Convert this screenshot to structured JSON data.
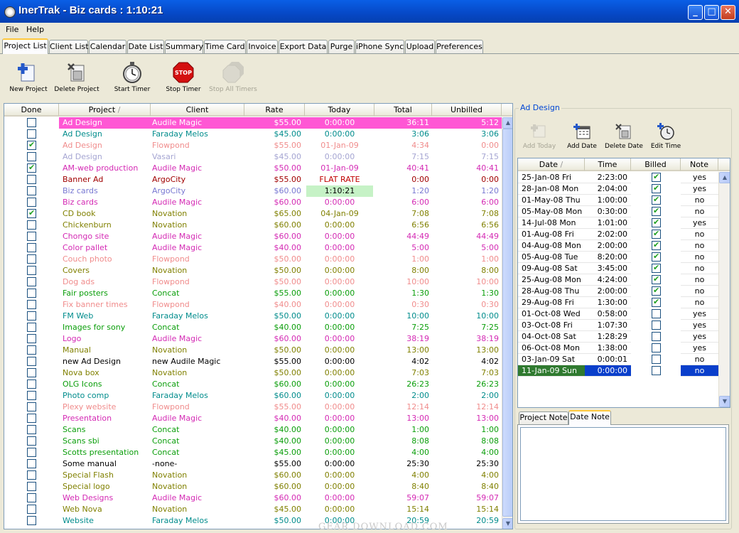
{
  "window": {
    "title": "InerTrak - Biz cards : 1:10:21",
    "minimize_glyph": "_",
    "maximize_glyph": "□",
    "close_glyph": "✕"
  },
  "menu": [
    "File",
    "Help"
  ],
  "tabs": [
    "Project List",
    "Client List",
    "Calendar",
    "Date List",
    "Summary",
    "Time Card",
    "Invoice",
    "Export Data",
    "Purge",
    "iPhone Sync",
    "Upload",
    "Preferences"
  ],
  "active_tab": "Project List",
  "toolbar": [
    {
      "label": "New Project",
      "icon": "new-project-icon",
      "enabled": true
    },
    {
      "label": "Delete Project",
      "icon": "delete-project-icon",
      "enabled": true
    },
    {
      "label": "Start Timer",
      "icon": "stopwatch-icon",
      "enabled": true
    },
    {
      "label": "Stop Timer",
      "icon": "stop-sign-icon",
      "enabled": true
    },
    {
      "label": "Stop All Timers",
      "icon": "stop-all-icon",
      "enabled": false
    }
  ],
  "project_table": {
    "columns": [
      "Done",
      "Project",
      "Client",
      "Rate",
      "Today",
      "Total",
      "Unbilled"
    ],
    "sort_indicator": "/",
    "rows": [
      {
        "done": false,
        "project": "Ad Design",
        "client": "Audile Magic",
        "rate": "$55.00",
        "today": "0:00:00",
        "total": "36:11",
        "unbilled": "5:12",
        "color": "#d42ab4",
        "selected": true
      },
      {
        "done": false,
        "project": "Ad Design",
        "client": "Faraday Melos",
        "rate": "$45.00",
        "today": "0:00:00",
        "total": "3:06",
        "unbilled": "3:06",
        "color": "#008c8c"
      },
      {
        "done": true,
        "project": "Ad Design",
        "client": "Flowpond",
        "rate": "$55.00",
        "today": "01-Jan-09",
        "total": "4:34",
        "unbilled": "0:00",
        "color": "#f08c8c"
      },
      {
        "done": false,
        "project": "Ad Design",
        "client": "Vasari",
        "rate": "$45.00",
        "today": "0:00:00",
        "total": "7:15",
        "unbilled": "7:15",
        "color": "#a5a5d2"
      },
      {
        "done": true,
        "project": "AM-web production",
        "client": "Audile Magic",
        "rate": "$50.00",
        "today": "01-Jan-09",
        "total": "40:41",
        "unbilled": "40:41",
        "color": "#d42ab4"
      },
      {
        "done": false,
        "project": "Banner Ad",
        "client": "ArgoCity",
        "rate": "$55.00",
        "today": "FLAT RATE",
        "total": "0:00",
        "unbilled": "0:00",
        "color": "#a00000",
        "today_color": "#c00000"
      },
      {
        "done": false,
        "project": "Biz cards",
        "client": "ArgoCity",
        "rate": "$60.00",
        "today": "1:10:21",
        "total": "1:20",
        "unbilled": "1:20",
        "color": "#7878d2",
        "today_highlight": true
      },
      {
        "done": false,
        "project": "Biz cards",
        "client": "Audile Magic",
        "rate": "$60.00",
        "today": "0:00:00",
        "total": "6:00",
        "unbilled": "6:00",
        "color": "#d42ab4"
      },
      {
        "done": true,
        "project": "CD book",
        "client": "Novation",
        "rate": "$65.00",
        "today": "04-Jan-09",
        "total": "7:08",
        "unbilled": "7:08",
        "color": "#808000"
      },
      {
        "done": false,
        "project": "Chickenburn",
        "client": "Novation",
        "rate": "$60.00",
        "today": "0:00:00",
        "total": "6:56",
        "unbilled": "6:56",
        "color": "#808000"
      },
      {
        "done": false,
        "project": "Chongo site",
        "client": "Audile Magic",
        "rate": "$60.00",
        "today": "0:00:00",
        "total": "44:49",
        "unbilled": "44:49",
        "color": "#d42ab4"
      },
      {
        "done": false,
        "project": "Color pallet",
        "client": "Audile Magic",
        "rate": "$40.00",
        "today": "0:00:00",
        "total": "5:00",
        "unbilled": "5:00",
        "color": "#d42ab4"
      },
      {
        "done": false,
        "project": "Couch photo",
        "client": "Flowpond",
        "rate": "$50.00",
        "today": "0:00:00",
        "total": "1:00",
        "unbilled": "1:00",
        "color": "#f08c8c"
      },
      {
        "done": false,
        "project": "Covers",
        "client": "Novation",
        "rate": "$50.00",
        "today": "0:00:00",
        "total": "8:00",
        "unbilled": "8:00",
        "color": "#808000"
      },
      {
        "done": false,
        "project": "Dog ads",
        "client": "Flowpond",
        "rate": "$50.00",
        "today": "0:00:00",
        "total": "10:00",
        "unbilled": "10:00",
        "color": "#f08c8c"
      },
      {
        "done": false,
        "project": "Fair posters",
        "client": "Concat",
        "rate": "$55.00",
        "today": "0:00:00",
        "total": "1:30",
        "unbilled": "1:30",
        "color": "#0a9e0a"
      },
      {
        "done": false,
        "project": "Fix banner times",
        "client": "Flowpond",
        "rate": "$40.00",
        "today": "0:00:00",
        "total": "0:30",
        "unbilled": "0:30",
        "color": "#f08c8c"
      },
      {
        "done": false,
        "project": "FM Web",
        "client": "Faraday Melos",
        "rate": "$50.00",
        "today": "0:00:00",
        "total": "10:00",
        "unbilled": "10:00",
        "color": "#008c8c"
      },
      {
        "done": false,
        "project": "Images for sony",
        "client": "Concat",
        "rate": "$40.00",
        "today": "0:00:00",
        "total": "7:25",
        "unbilled": "7:25",
        "color": "#0a9e0a"
      },
      {
        "done": false,
        "project": "Logo",
        "client": "Audile Magic",
        "rate": "$60.00",
        "today": "0:00:00",
        "total": "38:19",
        "unbilled": "38:19",
        "color": "#d42ab4"
      },
      {
        "done": false,
        "project": "Manual",
        "client": "Novation",
        "rate": "$50.00",
        "today": "0:00:00",
        "total": "13:00",
        "unbilled": "13:00",
        "color": "#808000"
      },
      {
        "done": false,
        "project": "new Ad Design",
        "client": "new Audile Magic",
        "rate": "$55.00",
        "today": "0:00:00",
        "total": "4:02",
        "unbilled": "4:02",
        "color": "#000000"
      },
      {
        "done": false,
        "project": "Nova box",
        "client": "Novation",
        "rate": "$50.00",
        "today": "0:00:00",
        "total": "7:03",
        "unbilled": "7:03",
        "color": "#808000"
      },
      {
        "done": false,
        "project": "OLG Icons",
        "client": "Concat",
        "rate": "$60.00",
        "today": "0:00:00",
        "total": "26:23",
        "unbilled": "26:23",
        "color": "#0a9e0a"
      },
      {
        "done": false,
        "project": "Photo comp",
        "client": "Faraday Melos",
        "rate": "$60.00",
        "today": "0:00:00",
        "total": "2:00",
        "unbilled": "2:00",
        "color": "#008c8c"
      },
      {
        "done": false,
        "project": "Plexy website",
        "client": "Flowpond",
        "rate": "$55.00",
        "today": "0:00:00",
        "total": "12:14",
        "unbilled": "12:14",
        "color": "#f08c8c"
      },
      {
        "done": false,
        "project": "Presentation",
        "client": "Audile Magic",
        "rate": "$40.00",
        "today": "0:00:00",
        "total": "13:00",
        "unbilled": "13:00",
        "color": "#d42ab4"
      },
      {
        "done": false,
        "project": "Scans",
        "client": "Concat",
        "rate": "$40.00",
        "today": "0:00:00",
        "total": "1:00",
        "unbilled": "1:00",
        "color": "#0a9e0a"
      },
      {
        "done": false,
        "project": "Scans sbi",
        "client": "Concat",
        "rate": "$40.00",
        "today": "0:00:00",
        "total": "8:08",
        "unbilled": "8:08",
        "color": "#0a9e0a"
      },
      {
        "done": false,
        "project": "Scotts presentation",
        "client": "Concat",
        "rate": "$45.00",
        "today": "0:00:00",
        "total": "4:00",
        "unbilled": "4:00",
        "color": "#0a9e0a"
      },
      {
        "done": false,
        "project": "Some manual",
        "client": "-none-",
        "rate": "$55.00",
        "today": "0:00:00",
        "total": "25:30",
        "unbilled": "25:30",
        "color": "#000000"
      },
      {
        "done": false,
        "project": "Special Flash",
        "client": "Novation",
        "rate": "$60.00",
        "today": "0:00:00",
        "total": "4:00",
        "unbilled": "4:00",
        "color": "#808000"
      },
      {
        "done": false,
        "project": "Special logo",
        "client": "Novation",
        "rate": "$60.00",
        "today": "0:00:00",
        "total": "8:40",
        "unbilled": "8:40",
        "color": "#808000"
      },
      {
        "done": false,
        "project": "Web Designs",
        "client": "Audile Magic",
        "rate": "$60.00",
        "today": "0:00:00",
        "total": "59:07",
        "unbilled": "59:07",
        "color": "#d42ab4"
      },
      {
        "done": false,
        "project": "Web Nova",
        "client": "Novation",
        "rate": "$45.00",
        "today": "0:00:00",
        "total": "15:14",
        "unbilled": "15:14",
        "color": "#808000"
      },
      {
        "done": false,
        "project": "Website",
        "client": "Faraday Melos",
        "rate": "$50.00",
        "today": "0:00:00",
        "total": "20:59",
        "unbilled": "20:59",
        "color": "#008c8c"
      }
    ]
  },
  "right_panel": {
    "group_title": "Ad Design",
    "toolbar": [
      {
        "label": "Add Today",
        "icon": "add-today-icon",
        "enabled": false
      },
      {
        "label": "Add Date",
        "icon": "add-date-icon",
        "enabled": true
      },
      {
        "label": "Delete Date",
        "icon": "delete-date-icon",
        "enabled": true
      },
      {
        "label": "Edit Time",
        "icon": "edit-time-icon",
        "enabled": true
      }
    ],
    "date_table": {
      "columns": [
        "Date",
        "Time",
        "Billed",
        "Note"
      ],
      "sort_indicator": "/",
      "rows": [
        {
          "date": "25-Jan-08 Fri",
          "time": "2:23:00",
          "billed": true,
          "note": "yes"
        },
        {
          "date": "28-Jan-08 Mon",
          "time": "2:04:00",
          "billed": true,
          "note": "yes"
        },
        {
          "date": "01-May-08 Thu",
          "time": "1:00:00",
          "billed": true,
          "note": "no"
        },
        {
          "date": "05-May-08 Mon",
          "time": "0:30:00",
          "billed": true,
          "note": "no"
        },
        {
          "date": "14-Jul-08 Mon",
          "time": "1:01:00",
          "billed": true,
          "note": "yes"
        },
        {
          "date": "01-Aug-08 Fri",
          "time": "2:02:00",
          "billed": true,
          "note": "no"
        },
        {
          "date": "04-Aug-08 Mon",
          "time": "2:00:00",
          "billed": true,
          "note": "no"
        },
        {
          "date": "05-Aug-08 Tue",
          "time": "8:20:00",
          "billed": true,
          "note": "no"
        },
        {
          "date": "09-Aug-08 Sat",
          "time": "3:45:00",
          "billed": true,
          "note": "no"
        },
        {
          "date": "25-Aug-08 Mon",
          "time": "4:24:00",
          "billed": true,
          "note": "no"
        },
        {
          "date": "28-Aug-08 Thu",
          "time": "2:00:00",
          "billed": true,
          "note": "no"
        },
        {
          "date": "29-Aug-08 Fri",
          "time": "1:30:00",
          "billed": true,
          "note": "no"
        },
        {
          "date": "01-Oct-08 Wed",
          "time": "0:58:00",
          "billed": false,
          "note": "yes"
        },
        {
          "date": "03-Oct-08 Fri",
          "time": "1:07:30",
          "billed": false,
          "note": "yes"
        },
        {
          "date": "04-Oct-08 Sat",
          "time": "1:28:29",
          "billed": false,
          "note": "yes"
        },
        {
          "date": "06-Oct-08 Mon",
          "time": "1:38:00",
          "billed": false,
          "note": "yes"
        },
        {
          "date": "03-Jan-09 Sat",
          "time": "0:00:01",
          "billed": false,
          "note": "no"
        },
        {
          "date": "11-Jan-09 Sun",
          "time": "0:00:00",
          "billed": false,
          "note": "no",
          "selected": true
        }
      ]
    },
    "note_tabs": [
      "Project Note",
      "Date Note"
    ],
    "active_note_tab": "Date Note",
    "note_text": ""
  },
  "watermark": "GEAR DOWNLOAD.COM"
}
